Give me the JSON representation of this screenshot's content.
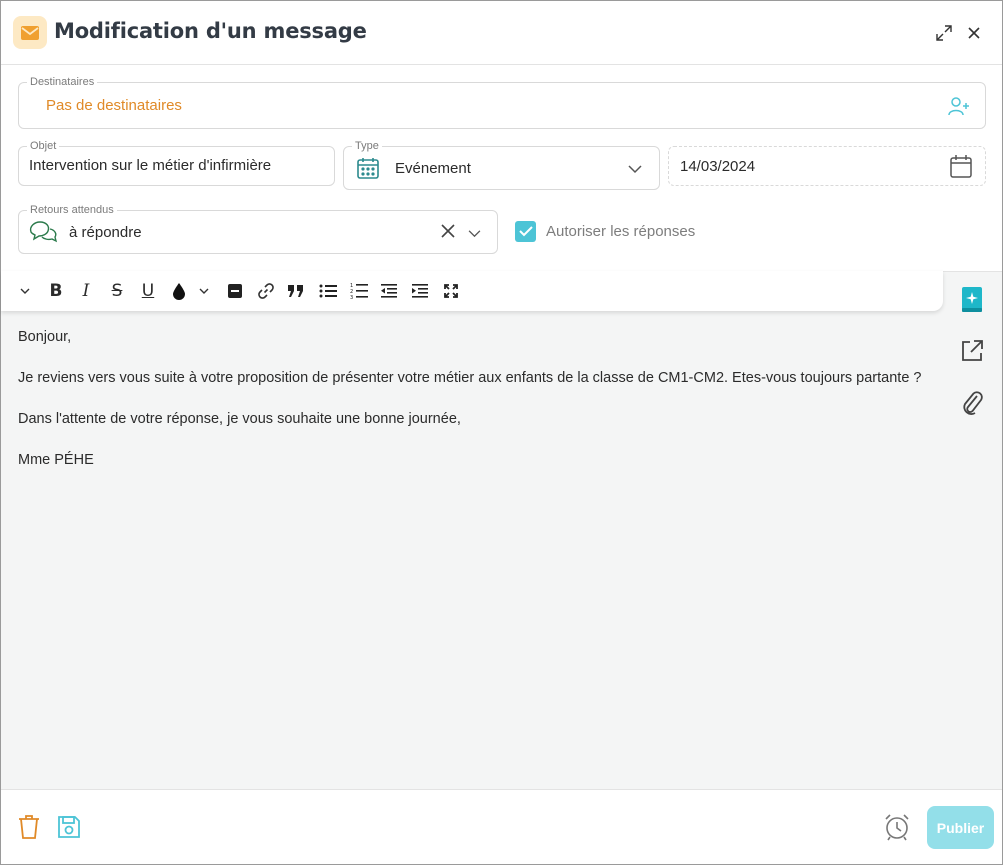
{
  "header": {
    "title": "Modification d'un message"
  },
  "form": {
    "recipients": {
      "legend": "Destinataires",
      "value": "Pas de destinataires"
    },
    "subject": {
      "legend": "Objet",
      "value": "Intervention sur le métier d'infirmière"
    },
    "type": {
      "legend": "Type",
      "value": "Evénement"
    },
    "date": {
      "value": "14/03/2024"
    },
    "expected_returns": {
      "legend": "Retours attendus",
      "value": "à répondre"
    },
    "allow_replies": {
      "label": "Autoriser les réponses",
      "checked": true
    }
  },
  "editor": {
    "paragraphs": [
      "Bonjour,",
      "Je reviens vers vous suite à votre proposition de présenter votre métier aux enfants de la classe de CM1-CM2. Etes-vous toujours partante ?",
      "Dans l'attente de votre réponse, je vous souhaite une bonne journée,",
      "Mme PÉHE"
    ]
  },
  "footer": {
    "publish_label": "Publier"
  },
  "colors": {
    "accent": "#4dc4d6",
    "orange": "#e08a28",
    "publish_disabled": "#93dfe9"
  }
}
